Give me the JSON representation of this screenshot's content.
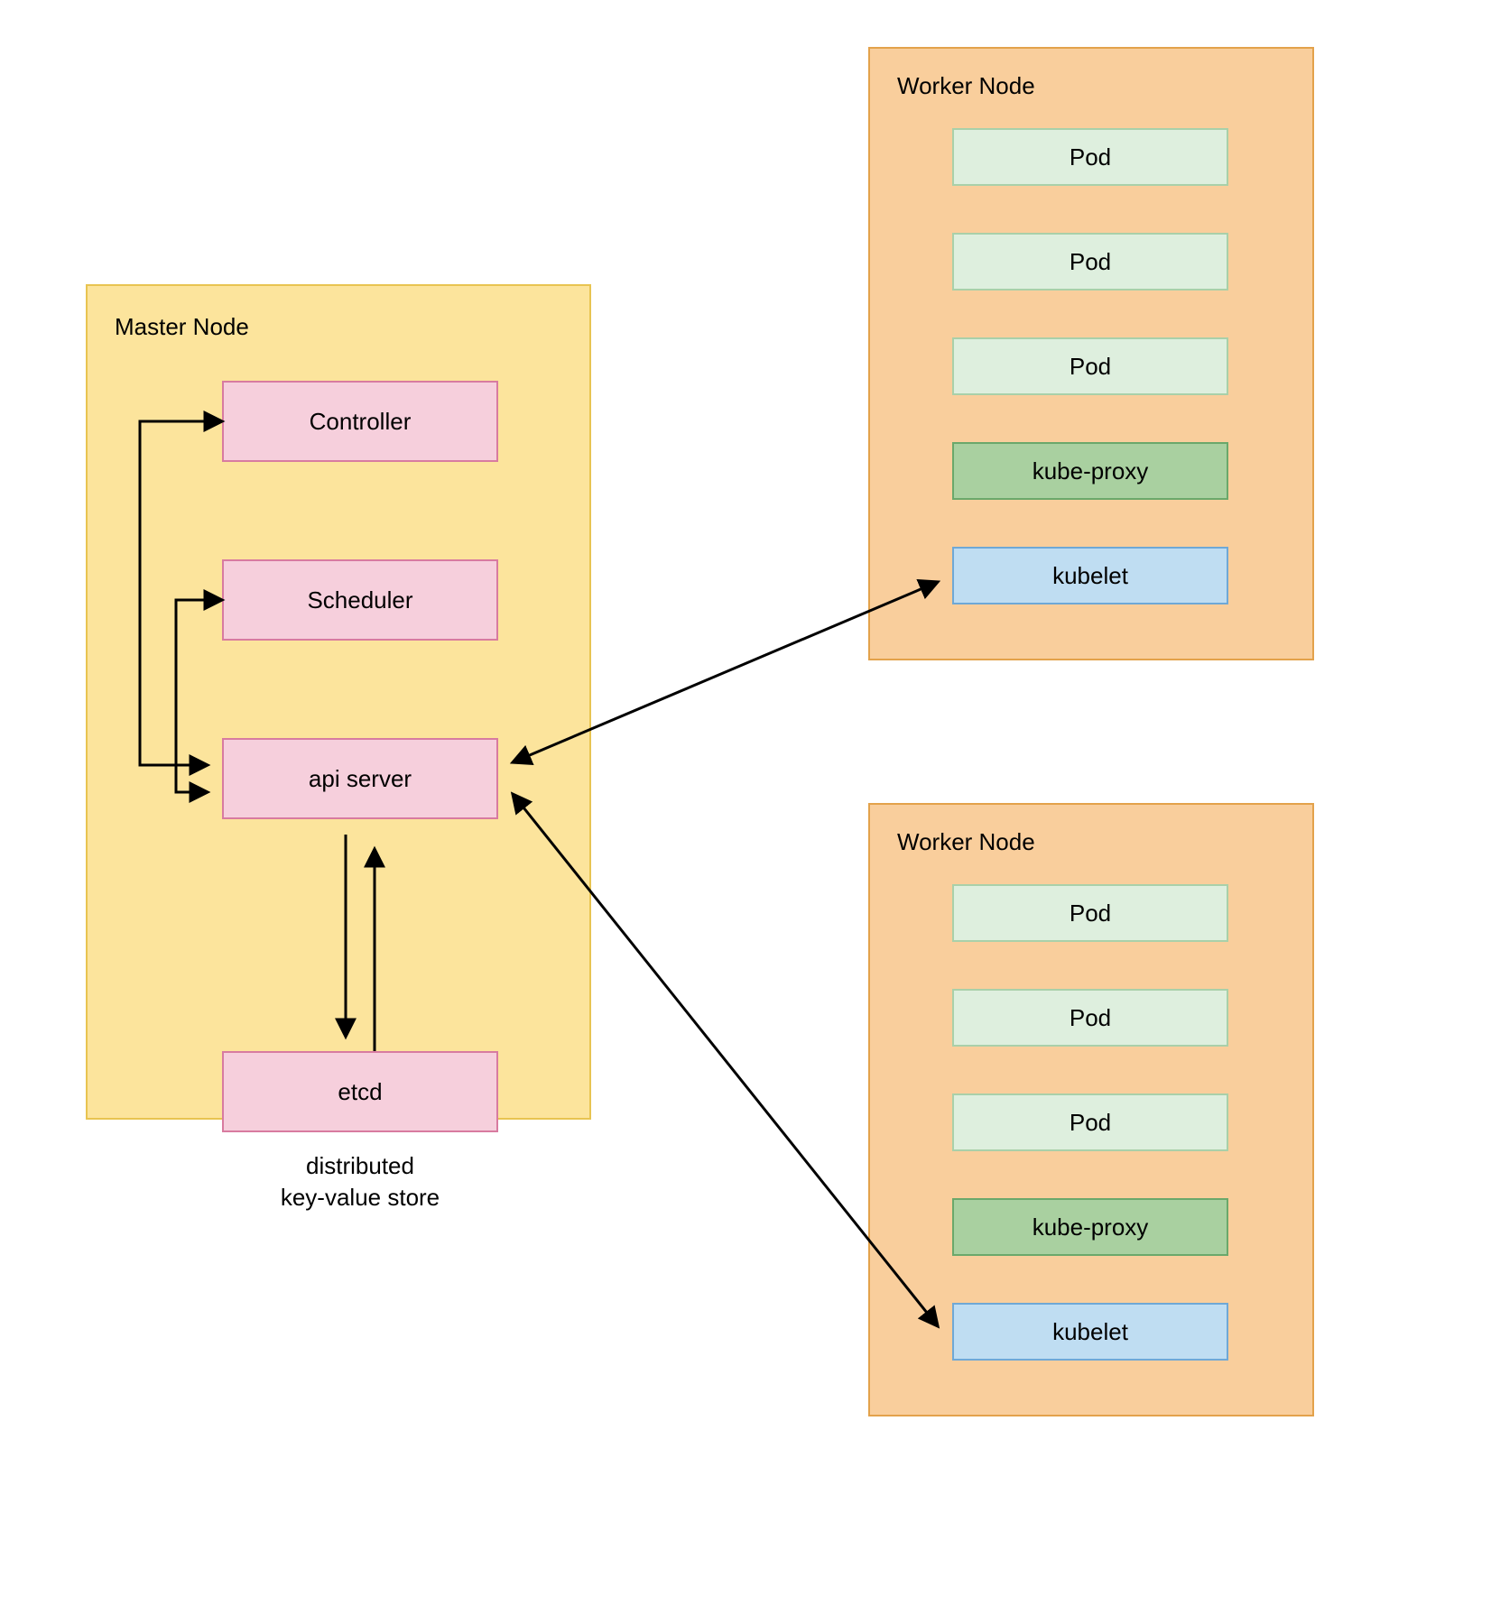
{
  "master": {
    "title": "Master Node",
    "controller": "Controller",
    "scheduler": "Scheduler",
    "api_server": "api server",
    "etcd": "etcd",
    "etcd_caption_line1": "distributed",
    "etcd_caption_line2": "key-value store"
  },
  "worker1": {
    "title": "Worker Node",
    "pod1": "Pod",
    "pod2": "Pod",
    "pod3": "Pod",
    "kube_proxy": "kube-proxy",
    "kubelet": "kubelet"
  },
  "worker2": {
    "title": "Worker Node",
    "pod1": "Pod",
    "pod2": "Pod",
    "pod3": "Pod",
    "kube_proxy": "kube-proxy",
    "kubelet": "kubelet"
  },
  "colors": {
    "master_bg": "#FCE49C",
    "master_border": "#E8C451",
    "worker_bg": "#F9CE9C",
    "worker_border": "#E3A24B",
    "pink_bg": "#F6CFDC",
    "pink_border": "#D87BA0",
    "pod_bg": "#DEEFDE",
    "pod_border": "#A9D0A9",
    "proxy_bg": "#A9D0A0",
    "proxy_border": "#6BA86B",
    "kubelet_bg": "#BFDDF2",
    "kubelet_border": "#6FA8D6"
  }
}
